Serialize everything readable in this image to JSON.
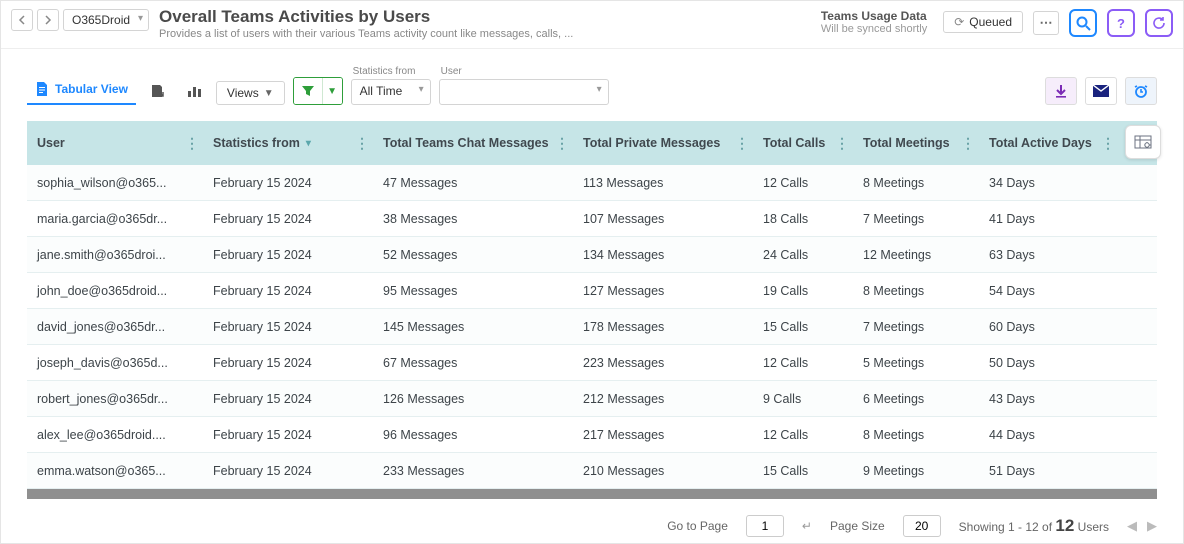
{
  "nav": {
    "source": "O365Droid"
  },
  "header": {
    "title": "Overall Teams Activities by Users",
    "subtitle": "Provides a list of users with their various Teams activity count like messages, calls, ...",
    "sync_title": "Teams Usage Data",
    "sync_sub": "Will be synced shortly",
    "queued": "Queued"
  },
  "toolbar": {
    "tab": "Tabular View",
    "views": "Views",
    "stats_lbl": "Statistics from",
    "stats_val": "All Time",
    "user_lbl": "User",
    "user_val": ""
  },
  "columns": [
    "User",
    "Statistics from",
    "Total Teams Chat Messages",
    "Total Private Messages",
    "Total Calls",
    "Total Meetings",
    "Total Active Days"
  ],
  "rows": [
    {
      "user": "sophia_wilson@o365...",
      "stat": "February 15 2024",
      "chat": "47 Messages",
      "priv": "113 Messages",
      "calls": "12 Calls",
      "meet": "8 Meetings",
      "days": "34 Days"
    },
    {
      "user": "maria.garcia@o365dr...",
      "stat": "February 15 2024",
      "chat": "38 Messages",
      "priv": "107 Messages",
      "calls": "18 Calls",
      "meet": "7 Meetings",
      "days": "41 Days"
    },
    {
      "user": "jane.smith@o365droi...",
      "stat": "February 15 2024",
      "chat": "52 Messages",
      "priv": "134 Messages",
      "calls": "24 Calls",
      "meet": "12 Meetings",
      "days": "63 Days"
    },
    {
      "user": "john_doe@o365droid...",
      "stat": "February 15 2024",
      "chat": "95 Messages",
      "priv": "127 Messages",
      "calls": "19 Calls",
      "meet": "8 Meetings",
      "days": "54 Days"
    },
    {
      "user": "david_jones@o365dr...",
      "stat": "February 15 2024",
      "chat": "145 Messages",
      "priv": "178 Messages",
      "calls": "15 Calls",
      "meet": "7 Meetings",
      "days": "60 Days"
    },
    {
      "user": "joseph_davis@o365d...",
      "stat": "February 15 2024",
      "chat": "67 Messages",
      "priv": "223 Messages",
      "calls": "12 Calls",
      "meet": "5 Meetings",
      "days": "50 Days"
    },
    {
      "user": "robert_jones@o365dr...",
      "stat": "February 15 2024",
      "chat": "126 Messages",
      "priv": "212 Messages",
      "calls": "9 Calls",
      "meet": "6 Meetings",
      "days": "43 Days"
    },
    {
      "user": "alex_lee@o365droid....",
      "stat": "February 15 2024",
      "chat": "96 Messages",
      "priv": "217 Messages",
      "calls": "12 Calls",
      "meet": "8 Meetings",
      "days": "44 Days"
    },
    {
      "user": "emma.watson@o365...",
      "stat": "February 15 2024",
      "chat": "233 Messages",
      "priv": "210 Messages",
      "calls": "15 Calls",
      "meet": "9 Meetings",
      "days": "51 Days"
    }
  ],
  "footer": {
    "goto": "Go to Page",
    "page": "1",
    "size_lbl": "Page Size",
    "size": "20",
    "show_pre": "Showing 1 - 12 of ",
    "show_num": "12",
    "show_suf": " Users"
  }
}
